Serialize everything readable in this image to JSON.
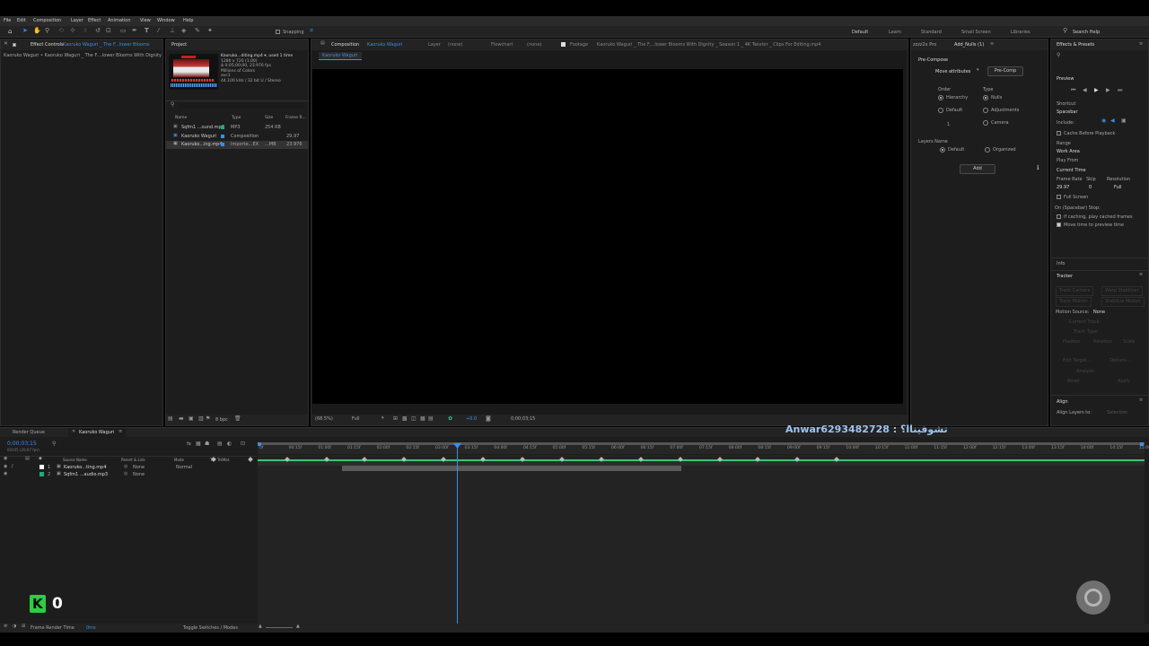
{
  "menu": [
    "File",
    "Edit",
    "Composition",
    "Layer",
    "Effect",
    "Animation",
    "View",
    "Window",
    "Help"
  ],
  "toolbar": {
    "snapping_label": "Snapping",
    "help_search": "Search Help"
  },
  "workspaces": [
    "Default",
    "Learn",
    "Standard",
    "Small Screen",
    "Libraries"
  ],
  "effect_controls": {
    "tab": "Effect Controls",
    "tab_target": "Kaoruko Waguri _ The F...lower Blooms",
    "breadcrumb": "Kaoruko Waguri • Kaoruko Waguri _ The F....lower Blooms With Dignity"
  },
  "project": {
    "tab": "Project",
    "info": [
      "Kaoruko...diting.mp4 ▾, used 1 time",
      "1280 x 720 (1.00)",
      "Δ 0;05;00;00, 23.976 fps",
      "Millions of Colors",
      "avc1",
      "44.100 kHz / 32 bit U / Stereo"
    ],
    "columns": [
      "Name",
      "Type",
      "Size",
      "Frame R..."
    ],
    "rows": [
      {
        "name": "Sqfm1 ...ound.mp3",
        "type": "MP3",
        "size": "254 KB",
        "fps": ""
      },
      {
        "name": "Kaoruko Waguri",
        "type": "Composition",
        "size": "",
        "fps": "29.97"
      },
      {
        "name": "Kaoruko...ing.mp4",
        "type": "Importe...EX",
        "size": "...MB",
        "fps": "23.976"
      }
    ],
    "bpc": "8 bpc"
  },
  "viewer": {
    "tabs": [
      {
        "label": "Composition",
        "target": "Kaoruko Waguri"
      },
      {
        "label": "Layer",
        "target": "(none)"
      },
      {
        "label": "Flowchart",
        "target": "(none)"
      },
      {
        "label": "Footage",
        "target": "Kaoruko Waguri _ The F....lower Blooms With Dignity _ Season 1 _ 4K Twixtor _ Clips For Editing.mp4"
      }
    ],
    "comp_name": "Kaoruko Waguri",
    "zoom": "(68.5%)",
    "resolution": "Full",
    "time_readout": "+0.0",
    "timecode": "0;00;03;15"
  },
  "pre_compose": {
    "tab1": "zzzz2x Pro",
    "tab2": "Add_Nulls (1)",
    "section": "Pre-Compose",
    "move_attr": "Move attributes",
    "precomp_btn": "Pre-Comp",
    "order_label": "Order",
    "type_label": "Type",
    "order": [
      "Hierarchy",
      "Default"
    ],
    "types": [
      "Nulls",
      "Adjustments",
      "Camera"
    ],
    "count": "1",
    "layers_name_label": "Layers Name",
    "names": [
      "Default",
      "Organized"
    ],
    "add_btn": "Add"
  },
  "effects_presets": {
    "tab": "Effects & Presets",
    "preview": "Preview",
    "shortcut_label": "Shortcut",
    "shortcut": "Spacebar",
    "include": "Include:",
    "cache": "Cache Before Playback",
    "range_label": "Range",
    "range": "Work Area",
    "play_from_label": "Play From",
    "play_from": "Current Time",
    "frame_rate_label": "Frame Rate",
    "skip_label": "Skip",
    "resolution_label": "Resolution",
    "frame_rate": "29.97",
    "skip": "0",
    "resolution": "Full",
    "full_screen": "Full Screen",
    "on_stop": "On (Spacebar) Stop:",
    "if_caching": "If caching, play cached frames",
    "move_time": "Move time to preview time",
    "info": "Info",
    "tracker": "Tracker",
    "track_items": [
      "Track Camera",
      "Warp Stabilizer",
      "Track Motion",
      "Stabilize Motion"
    ],
    "motion_source_label": "Motion Source:",
    "motion_source": "None",
    "current_track": "Current Track:",
    "track_type": "Track Type:",
    "position": "Position",
    "rotation": "Rotation",
    "scale": "Scale",
    "edit_target": "Edit Target...",
    "options": "Options...",
    "analyze": "Analyze:",
    "reset": "Reset",
    "apply": "Apply",
    "align": "Align",
    "align_layers_to": "Align Layers to:",
    "align_target": "Selection"
  },
  "timeline": {
    "render_queue": "Render Queue",
    "comp_tab": "Kaoruko Waguri",
    "timecode": "0;00;03;15",
    "fps_info": "00105 (29.97 fps)",
    "columns": [
      "Source Name",
      "Parent & Link",
      "Mode",
      "T",
      "TrkMat"
    ],
    "layers": [
      {
        "num": "1",
        "name": "Kaoruko...ting.mp4",
        "parent": "None",
        "mode": "Normal"
      },
      {
        "num": "2",
        "name": "Sqfm1 ...audio.mp3",
        "parent": "None",
        "mode": ""
      }
    ],
    "ruler": [
      "0f",
      "00:15f",
      "01:00f",
      "01:15f",
      "02:00f",
      "02:15f",
      "03:00f",
      "03:15f",
      "04:00f",
      "04:15f",
      "05:00f",
      "05:15f",
      "06:00f",
      "06:15f",
      "07:00f",
      "07:15f",
      "08:00f",
      "08:15f",
      "09:00f",
      "09:15f",
      "10:00f",
      "10:15f",
      "11:00f",
      "11:15f",
      "12:00f",
      "12:15f",
      "13:00f",
      "13:15f",
      "14:00f",
      "14:15f",
      "15:00f"
    ],
    "frame_render_label": "Frame Render Time",
    "frame_render_value": "0ms",
    "toggle": "Toggle Switches / Modes"
  },
  "overlay": {
    "contact": "Anwar6293482728 : تشوفيناا؟",
    "k_count": "0"
  }
}
